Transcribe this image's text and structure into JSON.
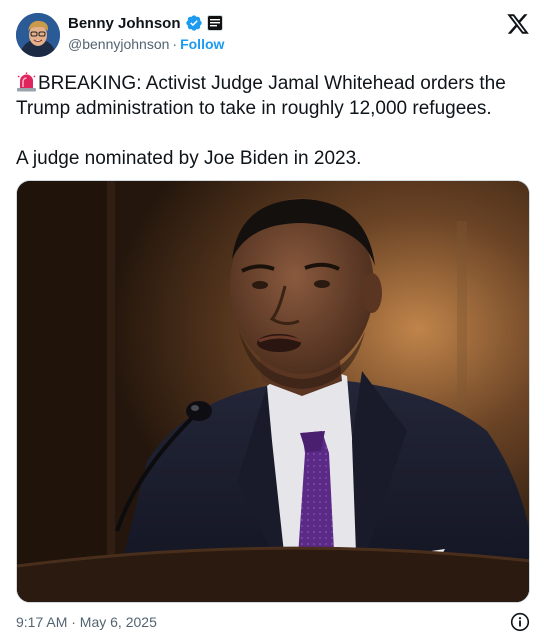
{
  "author": {
    "name": "Benny Johnson",
    "handle": "@bennyjohnson",
    "separator": "·",
    "follow_label": "Follow",
    "verified": true
  },
  "icons": {
    "avatar": "avatar-photo",
    "verified": "verified-badge-icon",
    "affiliation": "affiliation-badge-icon",
    "brand": "x-logo-icon",
    "siren": "rotating-light-icon",
    "info": "info-icon"
  },
  "tweet": {
    "line1": "BREAKING: Activist Judge Jamal Whitehead orders the Trump administration to take in roughly 12,000 refugees.",
    "line2": "A judge nominated by Joe Biden in 2023."
  },
  "footer": {
    "timestamp": "9:17 AM · May 6, 2025"
  },
  "colors": {
    "accent": "#1d9bf0",
    "text": "#0f1419",
    "muted": "#536471"
  }
}
